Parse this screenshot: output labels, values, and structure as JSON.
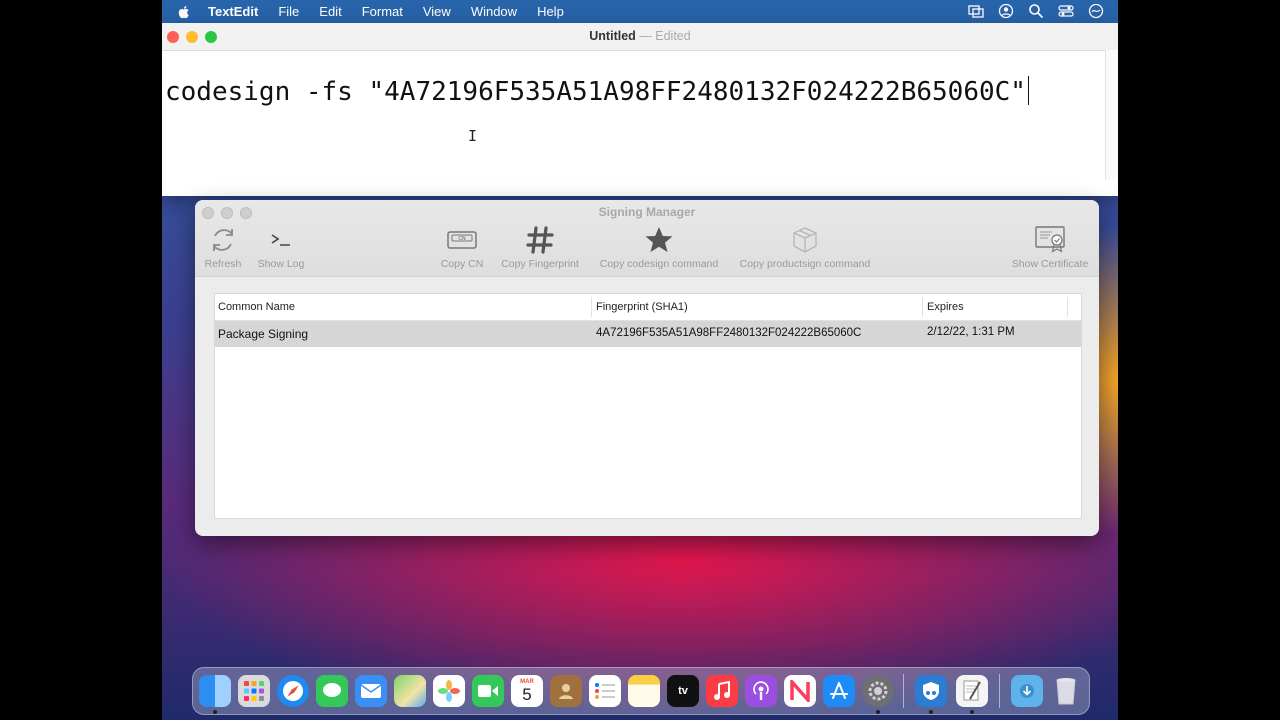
{
  "menubar": {
    "app_name": "TextEdit",
    "items": [
      "File",
      "Edit",
      "Format",
      "View",
      "Window",
      "Help"
    ]
  },
  "textedit": {
    "title": "Untitled",
    "separator": "—",
    "status": "Edited",
    "content": "codesign -fs \"4A72196F535A51A98FF2480132F024222B65060C\""
  },
  "signing_manager": {
    "title": "Signing Manager",
    "toolbar": {
      "refresh": "Refresh",
      "show_log": "Show Log",
      "copy_cn": "Copy CN",
      "copy_fingerprint": "Copy Fingerprint",
      "copy_codesign": "Copy codesign command",
      "copy_productsign": "Copy productsign command",
      "show_certificate": "Show Certificate",
      "cn_icon_text": "CN"
    },
    "table": {
      "columns": [
        "Common Name",
        "Fingerprint (SHA1)",
        "Expires"
      ],
      "rows": [
        {
          "name": "Package Signing",
          "fingerprint": "4A72196F535A51A98FF2480132F024222B65060C",
          "expires": "2/12/22, 1:31 PM"
        }
      ]
    }
  },
  "dock": {
    "calendar_month": "MAR",
    "calendar_day": "5",
    "tv_label": "tv"
  },
  "colors": {
    "menubar": "#2864aa",
    "selected_row": "#d6d6d6",
    "toolbar_text": "#9a9a9a"
  }
}
